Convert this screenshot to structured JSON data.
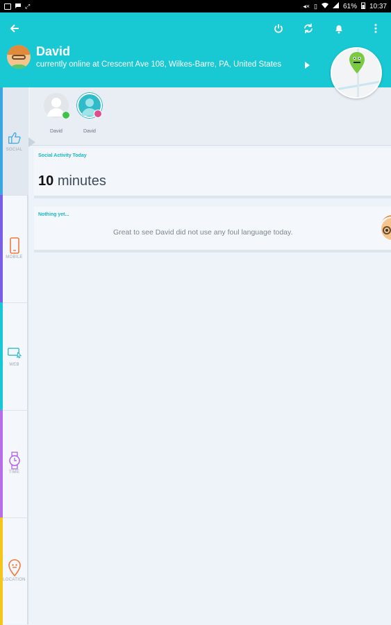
{
  "status_bar": {
    "battery": "61%",
    "time": "10:37"
  },
  "header": {
    "user_name": "David",
    "status_text": "currently online at Crescent Ave 108, Wilkes-Barre, PA, United States"
  },
  "sidebar": {
    "items": [
      {
        "label": "SOCIAL",
        "color": "#3aa7e0"
      },
      {
        "label": "MOBILE",
        "color": "#7b5ee8"
      },
      {
        "label": "WEB",
        "color": "#18c8d2"
      },
      {
        "label": "TIME",
        "color": "#b56ee8"
      },
      {
        "label": "LOCATION",
        "color": "#f5c518"
      }
    ]
  },
  "contacts": [
    {
      "name": "David",
      "badge": "phone"
    },
    {
      "name": "David",
      "badge": "instagram"
    }
  ],
  "activity": {
    "section_title": "Social Activity Today",
    "value": "10",
    "unit": "minutes"
  },
  "foul_language": {
    "section_title": "Nothing yet...",
    "message": "Great to see David did not use any foul language today."
  },
  "colors": {
    "accent": "#18c8d2",
    "title": "#18b6c4"
  }
}
